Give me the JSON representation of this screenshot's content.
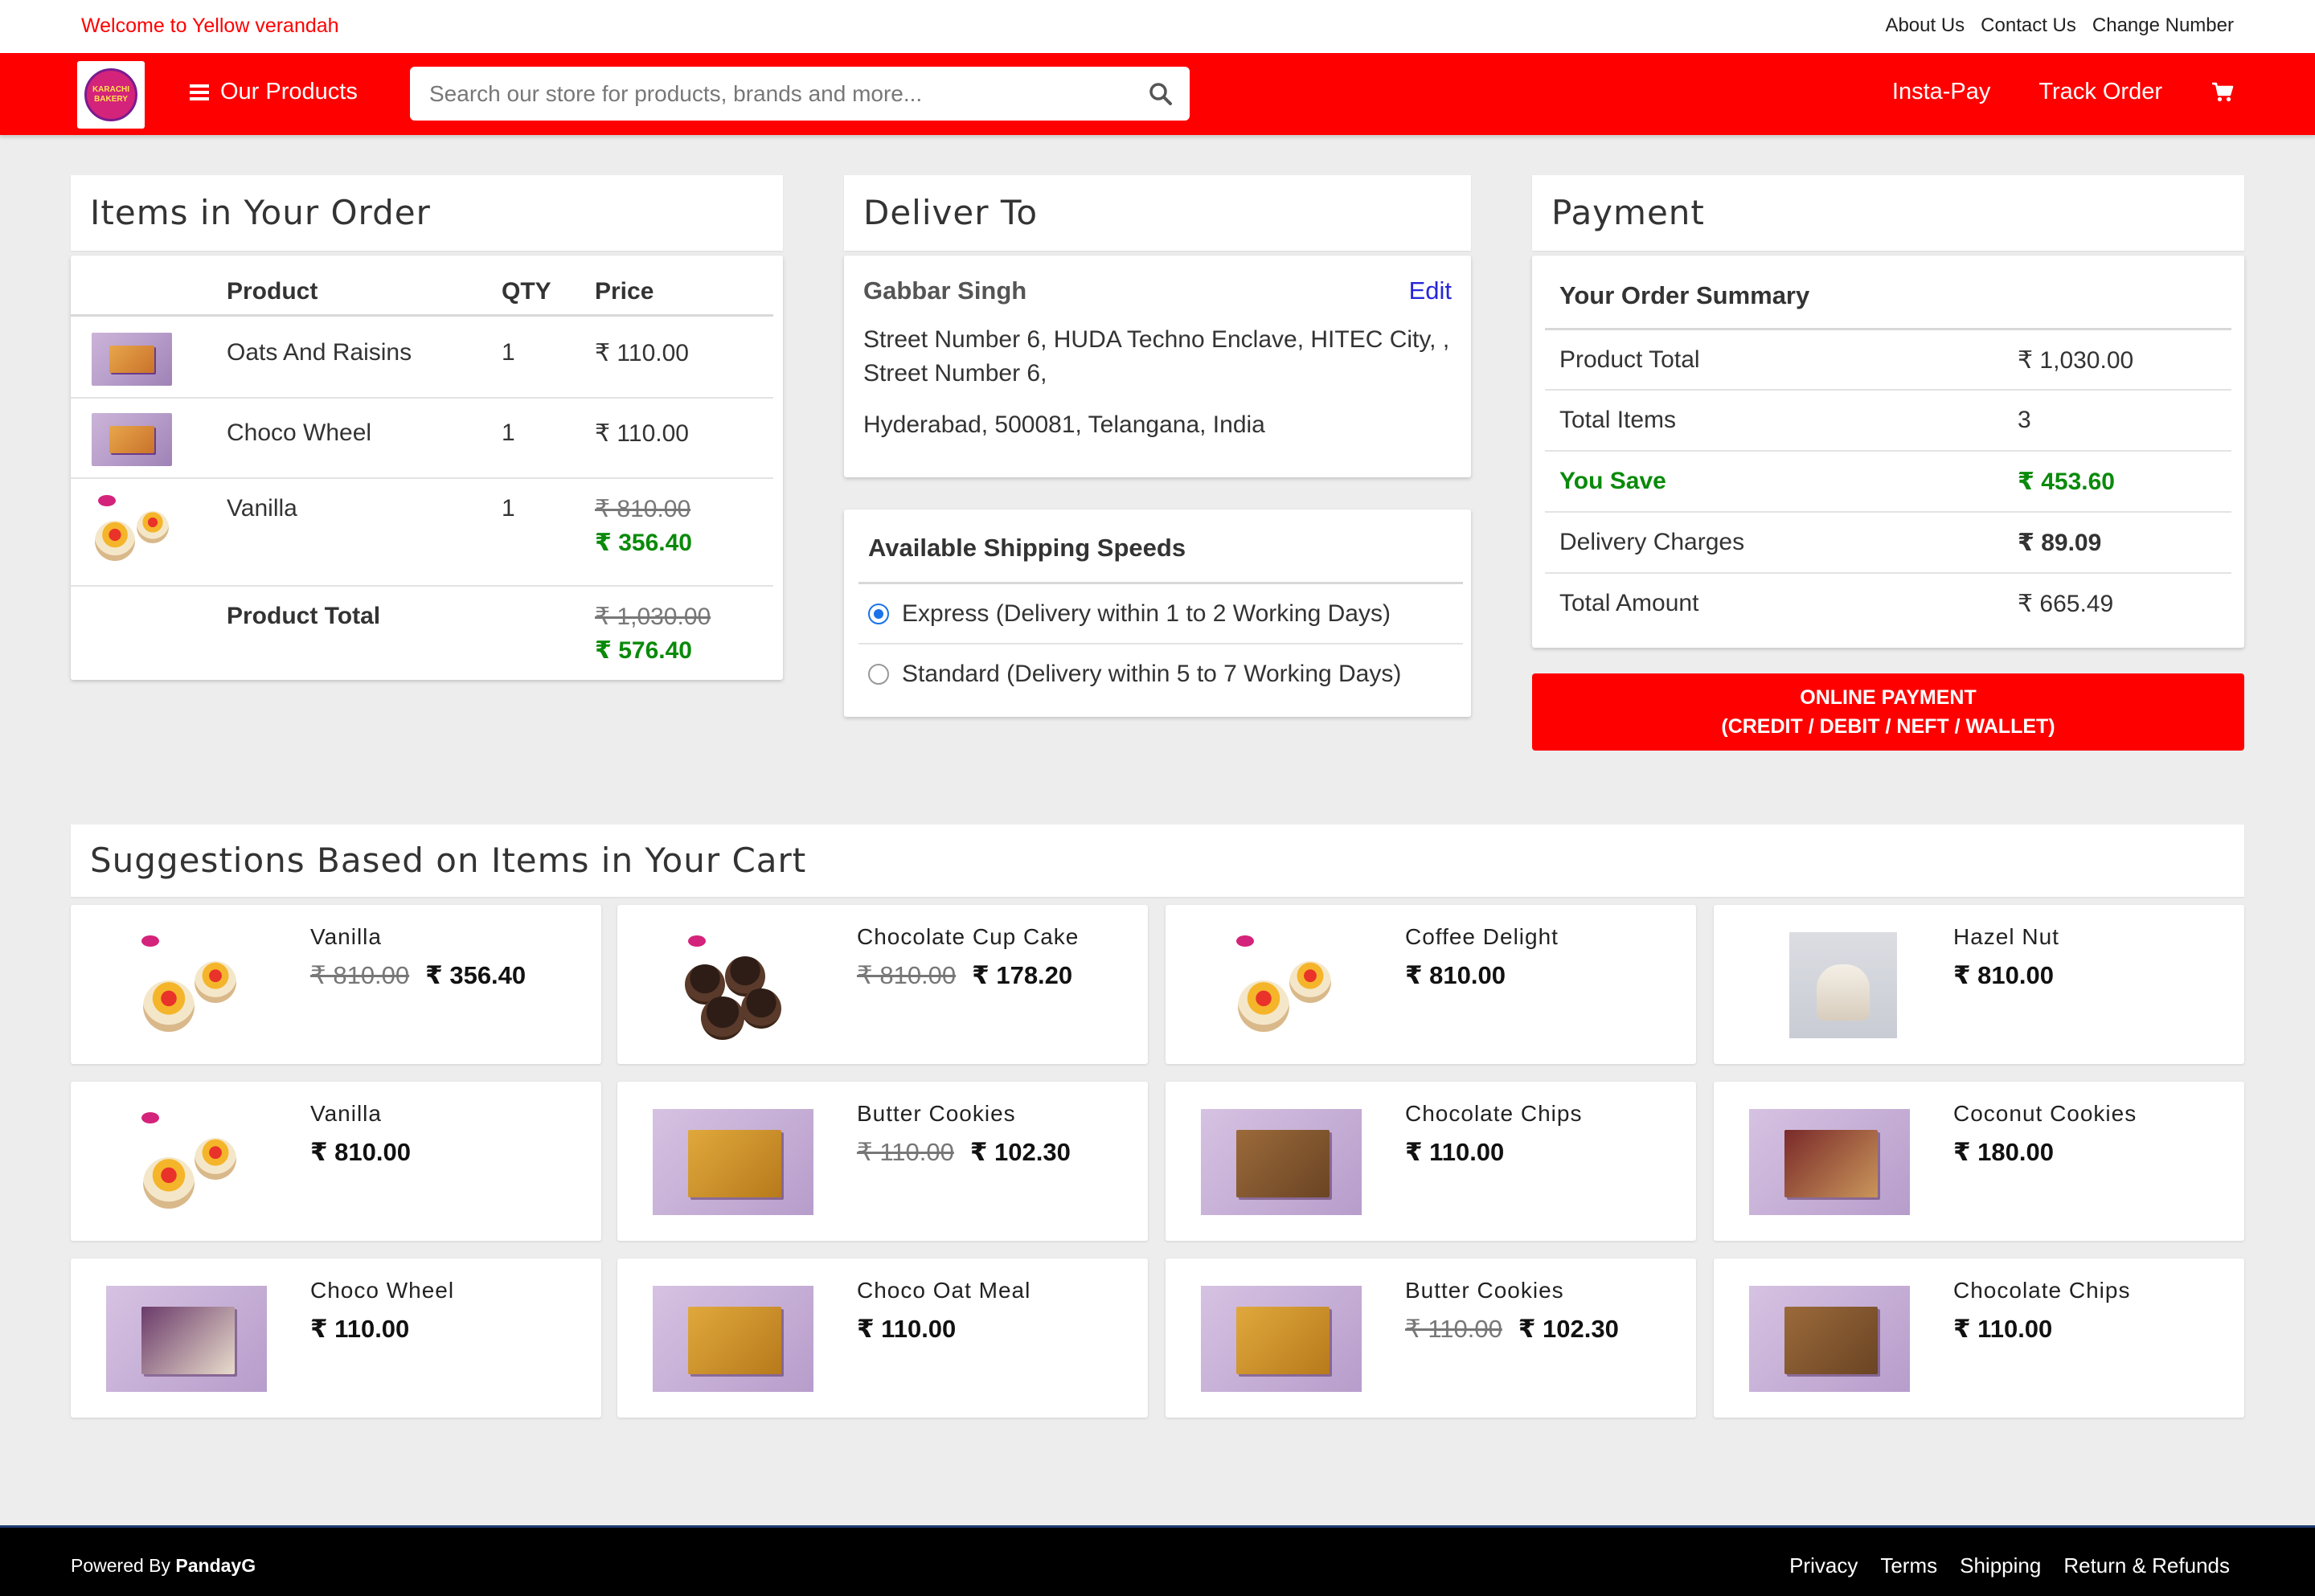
{
  "topbar": {
    "welcome": "Welcome to Yellow verandah",
    "links": [
      "About Us",
      "Contact Us",
      "Change Number"
    ]
  },
  "navbar": {
    "logo_text": "KARACHI BAKERY",
    "products_label": "Our Products",
    "search_placeholder": "Search our store for products, brands and more...",
    "insta_pay": "Insta-Pay",
    "track_order": "Track Order",
    "accent_color": "#ff0000"
  },
  "order": {
    "title": "Items in Your Order",
    "headers": {
      "product": "Product",
      "qty": "QTY",
      "price": "Price"
    },
    "items": [
      {
        "name": "Oats And Raisins",
        "qty": "1",
        "price": "₹ 110.00",
        "old_price": "",
        "image": "box"
      },
      {
        "name": "Choco Wheel",
        "qty": "1",
        "price": "₹ 110.00",
        "old_price": "",
        "image": "box"
      },
      {
        "name": "Vanilla",
        "qty": "1",
        "price": "₹ 356.40",
        "old_price": "₹ 810.00",
        "image": "cupcake"
      }
    ],
    "total_label": "Product Total",
    "total_old": "₹ 1,030.00",
    "total_new": "₹ 576.40"
  },
  "delivery": {
    "title": "Deliver To",
    "name": "Gabbar Singh",
    "edit": "Edit",
    "address_line1": "Street Number 6, HUDA Techno Enclave, HITEC City, , Street Number 6,",
    "address_line2": "Hyderabad, 500081, Telangana, India"
  },
  "shipping": {
    "title": "Available Shipping Speeds",
    "options": [
      {
        "label": "Express (Delivery within 1 to 2 Working Days)",
        "selected": true
      },
      {
        "label": "Standard (Delivery within 5 to 7 Working Days)",
        "selected": false
      }
    ]
  },
  "payment": {
    "title": "Payment",
    "summary_title": "Your Order Summary",
    "rows": [
      {
        "label": "Product Total",
        "value": "₹ 1,030.00"
      },
      {
        "label": "Total Items",
        "value": "3"
      },
      {
        "label": "You Save",
        "value": "₹ 453.60"
      },
      {
        "label": "Delivery Charges",
        "value": "₹ 89.09"
      },
      {
        "label": "Total Amount",
        "value": "₹ 665.49"
      }
    ],
    "button_line1": "ONLINE PAYMENT",
    "button_line2": "(CREDIT / DEBIT / NEFT / WALLET)"
  },
  "suggestions": {
    "title": "Suggestions Based on Items in Your Cart",
    "items": [
      {
        "name": "Vanilla",
        "old_price": "₹ 810.00",
        "price": "₹ 356.40",
        "image": "cupcake-vanilla"
      },
      {
        "name": "Chocolate Cup Cake",
        "old_price": "₹ 810.00",
        "price": "₹ 178.20",
        "image": "cupcake-chocolate"
      },
      {
        "name": "Coffee Delight",
        "old_price": "",
        "price": "₹ 810.00",
        "image": "cupcake-vanilla"
      },
      {
        "name": "Hazel Nut",
        "old_price": "",
        "price": "₹ 810.00",
        "image": "dessert-cup"
      },
      {
        "name": "Vanilla",
        "old_price": "",
        "price": "₹ 810.00",
        "image": "cupcake-vanilla"
      },
      {
        "name": "Butter Cookies",
        "old_price": "₹ 110.00",
        "price": "₹ 102.30",
        "image": "box-yellow"
      },
      {
        "name": "Chocolate Chips",
        "old_price": "",
        "price": "₹ 110.00",
        "image": "box-brown"
      },
      {
        "name": "Coconut Cookies",
        "old_price": "",
        "price": "₹ 180.00",
        "image": "box-maroon"
      },
      {
        "name": "Choco Wheel",
        "old_price": "",
        "price": "₹ 110.00",
        "image": "box-purple"
      },
      {
        "name": "Choco Oat Meal",
        "old_price": "",
        "price": "₹ 110.00",
        "image": "box-yellow"
      },
      {
        "name": "Butter Cookies",
        "old_price": "₹ 110.00",
        "price": "₹ 102.30",
        "image": "box-yellow"
      },
      {
        "name": "Chocolate Chips",
        "old_price": "",
        "price": "₹ 110.00",
        "image": "box-brown"
      }
    ]
  },
  "footer": {
    "powered_prefix": "Powered By",
    "powered_brand": "PandayG",
    "links": [
      "Privacy",
      "Terms",
      "Shipping",
      "Return & Refunds"
    ]
  }
}
